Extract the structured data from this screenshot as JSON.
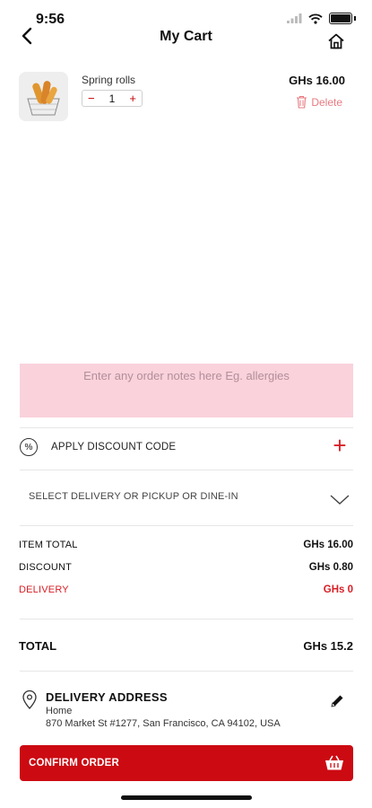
{
  "status_bar": {
    "time": "9:56"
  },
  "header": {
    "title": "My Cart"
  },
  "cart": {
    "items": [
      {
        "name": "Spring rolls",
        "quantity": "1",
        "price": "GHs 16.00",
        "delete_label": "Delete",
        "minus": "−",
        "plus": "+"
      }
    ]
  },
  "notes": {
    "placeholder": "Enter any order notes here Eg. allergies"
  },
  "discount": {
    "icon_text": "%",
    "label": "APPLY DISCOUNT CODE",
    "add": "+"
  },
  "delivery_select": {
    "label": "SELECT DELIVERY OR PICKUP OR DINE-IN"
  },
  "summary": {
    "item_total_label": "ITEM TOTAL",
    "item_total_value": "GHs 16.00",
    "discount_label": "DISCOUNT",
    "discount_value": "GHs 0.80",
    "delivery_label": "DELIVERY",
    "delivery_value": "GHs 0",
    "total_label": "TOTAL",
    "total_value": "GHs 15.2"
  },
  "address": {
    "title": "DELIVERY ADDRESS",
    "label": "Home",
    "line": "870 Market St #1277, San Francisco, CA 94102, USA"
  },
  "confirm": {
    "label": "CONFIRM ORDER"
  },
  "colors": {
    "accent": "#cc0a12",
    "notes_bg": "#f9d2dc",
    "delete": "#e87a80"
  }
}
